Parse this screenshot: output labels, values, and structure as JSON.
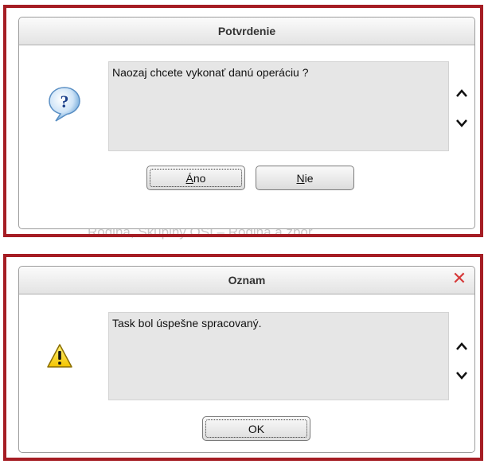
{
  "dialog1": {
    "title": "Potvrdenie",
    "message": "Naozaj chcete vykonať danú operáciu ?",
    "icon": "question-icon",
    "btn_yes": {
      "mnemonic": "Á",
      "rest": "no"
    },
    "btn_no": {
      "mnemonic": "N",
      "rest": "ie"
    }
  },
  "dialog2": {
    "title": "Oznam",
    "message": "Task bol úspešne spracovaný.",
    "icon": "warning-icon",
    "btn_ok": "OK",
    "close_glyph": "✕"
  },
  "background_text": "Rodina, Skupiny OSI – Rodina a zbor",
  "colors": {
    "frame_border": "#a51d24",
    "close": "#d63a3a"
  }
}
